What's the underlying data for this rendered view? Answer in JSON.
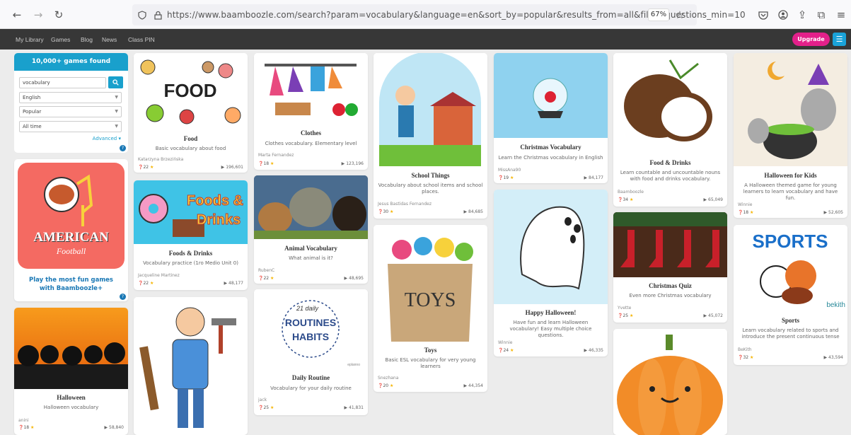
{
  "browser": {
    "url": "https://www.baamboozle.com/search?param=vocabulary&language=en&sort_by=popular&results_from=all&filter_questions_min=10",
    "url_host": "baamboozle.com",
    "zoom": "67%"
  },
  "nav": {
    "items": [
      "My Library",
      "Games",
      "Blog",
      "News",
      "Class PIN"
    ],
    "upgrade": "Upgrade"
  },
  "search": {
    "heading": "10,000+ games found",
    "query": "vocabulary",
    "language": "English",
    "sort": "Popular",
    "time": "All time",
    "advanced": "Advanced ▾"
  },
  "promo": {
    "text": "Play the most fun games with Baamboozle+",
    "logo_line1": "AMERICAN",
    "logo_line2": "Football"
  },
  "colors": {
    "accent": "#19a0cc",
    "upgrade": "#e3208a",
    "star": "#f5b400"
  },
  "cards": [
    {
      "title": "Food",
      "desc": "Basic vocabulary about food",
      "author": "Katarzyna Brzezińska",
      "stats": "22",
      "plays": "196,601",
      "thumb_text": "FOOD"
    },
    {
      "title": "Clothes",
      "desc": "Clothes vocabulary. Elementary level",
      "author": "Marta Fernandez",
      "stats": "18",
      "plays": "123,196",
      "thumb_text": ""
    },
    {
      "title": "School Things",
      "desc": "Vocabulary about school items and school places.",
      "author": "Jesus Bastidas Fernandez",
      "stats": "30",
      "plays": "84,685",
      "thumb_text": ""
    },
    {
      "title": "Christmas Vocabulary",
      "desc": "Learn the Christmas vocabulary in English",
      "author": "MissAna90",
      "stats": "19",
      "plays": "84,177",
      "thumb_text": ""
    },
    {
      "title": "Food & Drinks",
      "desc": "Learn countable and uncountable nouns with food and drinks vocabulary.",
      "author": "Baamboozle",
      "stats": "34",
      "plays": "65,049",
      "thumb_text": ""
    },
    {
      "title": "Halloween for Kids",
      "desc": "A Halloween themed game for young learners to learn vocabulary and have fun.",
      "author": "Winnie",
      "stats": "18",
      "plays": "52,605",
      "thumb_text": ""
    },
    {
      "title": "Foods & Drinks",
      "desc": "Vocabulary practice (1ro Medio Unit 0)",
      "author": "Jacqueline Martinez",
      "stats": "22",
      "plays": "48,177",
      "thumb_text": "Foods & Drinks"
    },
    {
      "title": "Animal Vocabulary",
      "desc": "What animal is it?",
      "author": "RubenC",
      "stats": "22",
      "plays": "48,695",
      "thumb_text": ""
    },
    {
      "title": "Toys",
      "desc": "Basic ESL vocabulary for very young learners",
      "author": "Snezhana",
      "stats": "20",
      "plays": "44,354",
      "thumb_text": "TOYS"
    },
    {
      "title": "Happy Halloween!",
      "desc": "Have fun and learn Halloween vocabulary! Easy multiple choice questions.",
      "author": "Winnie",
      "stats": "24",
      "plays": "46,335",
      "thumb_text": ""
    },
    {
      "title": "Christmas Quiz",
      "desc": "Even more Christmas vocabulary",
      "author": "Yvette",
      "stats": "25",
      "plays": "45,072",
      "thumb_text": ""
    },
    {
      "title": "Sports",
      "desc": "Learn vocabulary related to sports and introduce the present continuous tense",
      "author": "BeKith",
      "stats": "32",
      "plays": "43,594",
      "thumb_text": "SPORTS"
    },
    {
      "title": "Halloween",
      "desc": "Halloween vocabulary",
      "author": "anini",
      "stats": "18",
      "plays": "58,840",
      "thumb_text": ""
    },
    {
      "title": "Daily Routine",
      "desc": "Vocabulary for your daily routine",
      "author": "jack",
      "stats": "25",
      "plays": "41,831",
      "thumb_text": "21 daily ROUTINES AND HABITS"
    }
  ],
  "extra": {
    "bekith": "bekith",
    "eplanno": "eplanno"
  }
}
